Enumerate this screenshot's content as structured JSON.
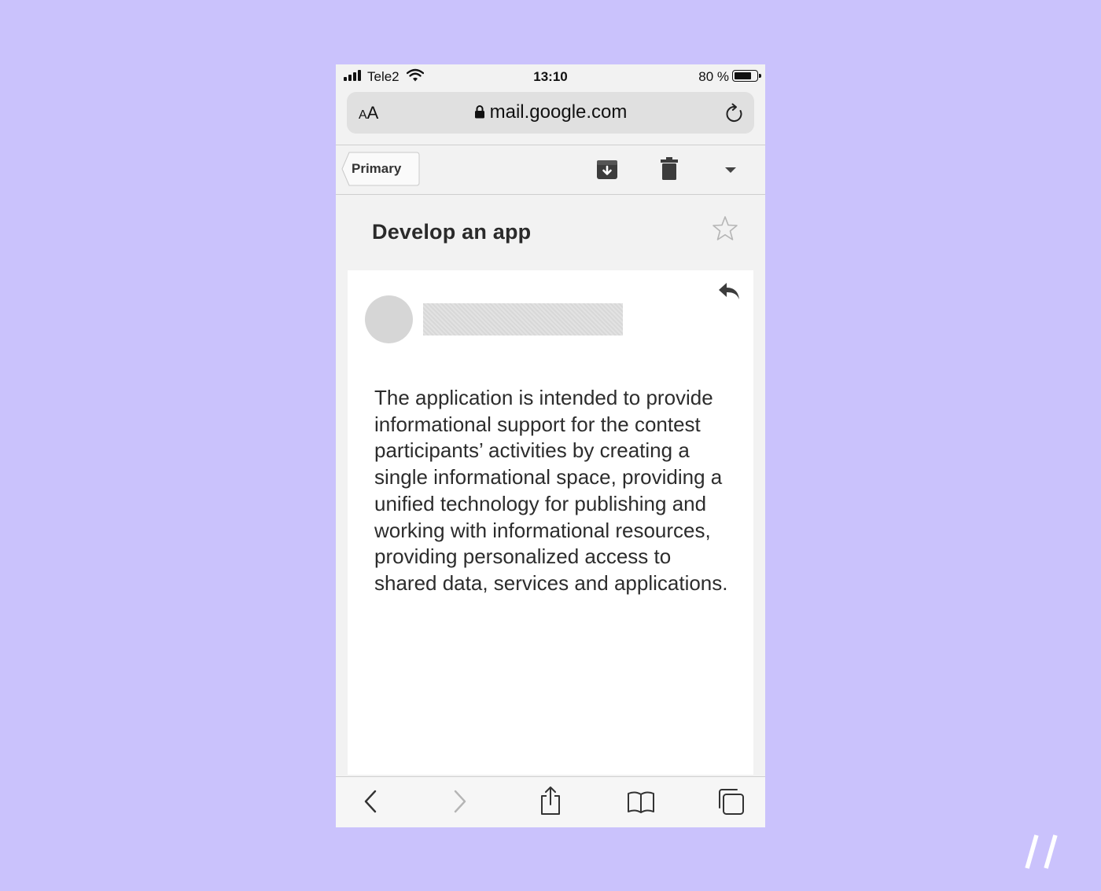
{
  "status_bar": {
    "carrier": "Tele2",
    "time": "13:10",
    "battery_percent": "80 %",
    "battery_level": 0.8,
    "icons": [
      "signal-icon",
      "wifi-icon",
      "battery-icon"
    ]
  },
  "url_bar": {
    "text_size_label": "AA",
    "url": "mail.google.com",
    "icons": [
      "lock-icon",
      "reload-icon"
    ]
  },
  "toolbar": {
    "back_label": "Primary",
    "icons": [
      "archive-icon",
      "trash-icon",
      "chevron-down-icon"
    ]
  },
  "message": {
    "subject": "Develop an app",
    "body": "The application is intended to provide informational support for the contest participants’ activities by creating a single informational space, providing a unified technology for publishing and working with informational resources, providing personalized access to shared data, services and applications.",
    "icons": [
      "star-icon",
      "reply-icon",
      "avatar"
    ]
  },
  "bottom_bar": {
    "icons": [
      "back-arrow-icon",
      "forward-arrow-icon",
      "share-icon",
      "bookmarks-icon",
      "tabs-icon"
    ]
  },
  "colors": {
    "background": "#cac2fc",
    "phone_background": "#f2f2f2",
    "card_background": "#ffffff",
    "text": "#2c2c2c"
  }
}
